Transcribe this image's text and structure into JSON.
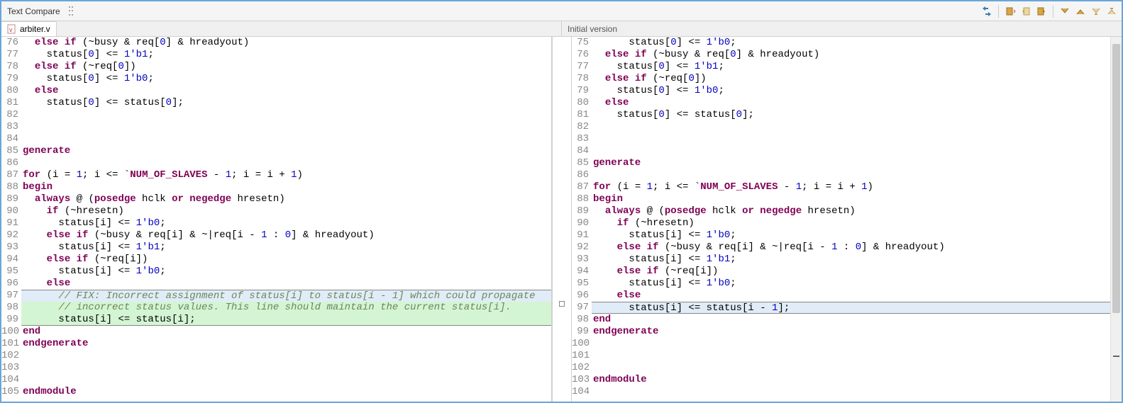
{
  "title": "Text Compare",
  "file_left": "arbiter.v",
  "file_right": "Initial version",
  "toolbar_icons": [
    "swap",
    "copy-all-left",
    "copy-left",
    "copy-right",
    "next-diff",
    "prev-diff",
    "next-change",
    "prev-change"
  ],
  "left_lines": [
    {
      "n": 76,
      "t": "  else if (~busy & req[0] & hreadyout)"
    },
    {
      "n": 77,
      "t": "    status[0] <= 1'b1;"
    },
    {
      "n": 78,
      "t": "  else if (~req[0])"
    },
    {
      "n": 79,
      "t": "    status[0] <= 1'b0;"
    },
    {
      "n": 80,
      "t": "  else"
    },
    {
      "n": 81,
      "t": "    status[0] <= status[0];"
    },
    {
      "n": 82,
      "t": ""
    },
    {
      "n": 83,
      "t": ""
    },
    {
      "n": 84,
      "t": ""
    },
    {
      "n": 85,
      "t": "generate"
    },
    {
      "n": 86,
      "t": ""
    },
    {
      "n": 87,
      "t": "for (i = 1; i <= `NUM_OF_SLAVES - 1; i = i + 1)"
    },
    {
      "n": 88,
      "t": "begin"
    },
    {
      "n": 89,
      "t": "  always @ (posedge hclk or negedge hresetn)"
    },
    {
      "n": 90,
      "t": "    if (~hresetn)"
    },
    {
      "n": 91,
      "t": "      status[i] <= 1'b0;"
    },
    {
      "n": 92,
      "t": "    else if (~busy & req[i] & ~|req[i - 1 : 0] & hreadyout)"
    },
    {
      "n": 93,
      "t": "      status[i] <= 1'b1;"
    },
    {
      "n": 94,
      "t": "    else if (~req[i])"
    },
    {
      "n": 95,
      "t": "      status[i] <= 1'b0;"
    },
    {
      "n": 96,
      "t": "    else"
    },
    {
      "n": 97,
      "t": "      // FIX: Incorrect assignment of status[i] to status[i - 1] which could propagate",
      "cls": "diff-add diff-chg"
    },
    {
      "n": 98,
      "t": "      // incorrect status values. This line should maintain the current status[i].",
      "cls": "diff-add"
    },
    {
      "n": 99,
      "t": "      status[i] <= status[i];",
      "cls": "diff-add"
    },
    {
      "n": 100,
      "t": "end"
    },
    {
      "n": 101,
      "t": "endgenerate"
    },
    {
      "n": 102,
      "t": ""
    },
    {
      "n": 103,
      "t": ""
    },
    {
      "n": 104,
      "t": ""
    },
    {
      "n": 105,
      "t": "endmodule"
    }
  ],
  "right_lines": [
    {
      "n": 75,
      "t": "      status[0] <= 1'b0;"
    },
    {
      "n": 76,
      "t": "  else if (~busy & req[0] & hreadyout)"
    },
    {
      "n": 77,
      "t": "    status[0] <= 1'b1;"
    },
    {
      "n": 78,
      "t": "  else if (~req[0])"
    },
    {
      "n": 79,
      "t": "    status[0] <= 1'b0;"
    },
    {
      "n": 80,
      "t": "  else"
    },
    {
      "n": 81,
      "t": "    status[0] <= status[0];"
    },
    {
      "n": 82,
      "t": ""
    },
    {
      "n": 83,
      "t": ""
    },
    {
      "n": 84,
      "t": ""
    },
    {
      "n": 85,
      "t": "generate"
    },
    {
      "n": 86,
      "t": ""
    },
    {
      "n": 87,
      "t": "for (i = 1; i <= `NUM_OF_SLAVES - 1; i = i + 1)"
    },
    {
      "n": 88,
      "t": "begin"
    },
    {
      "n": 89,
      "t": "  always @ (posedge hclk or negedge hresetn)"
    },
    {
      "n": 90,
      "t": "    if (~hresetn)"
    },
    {
      "n": 91,
      "t": "      status[i] <= 1'b0;"
    },
    {
      "n": 92,
      "t": "    else if (~busy & req[i] & ~|req[i - 1 : 0] & hreadyout)"
    },
    {
      "n": 93,
      "t": "      status[i] <= 1'b1;"
    },
    {
      "n": 94,
      "t": "    else if (~req[i])"
    },
    {
      "n": 95,
      "t": "      status[i] <= 1'b0;"
    },
    {
      "n": 96,
      "t": "    else"
    },
    {
      "n": 97,
      "t": "      status[i] <= status[i - 1];",
      "cls": "diff-chg"
    },
    {
      "n": 98,
      "t": "end"
    },
    {
      "n": 99,
      "t": "endgenerate"
    },
    {
      "n": 100,
      "t": ""
    },
    {
      "n": 101,
      "t": ""
    },
    {
      "n": 102,
      "t": ""
    },
    {
      "n": 103,
      "t": "endmodule"
    },
    {
      "n": 104,
      "t": ""
    }
  ]
}
